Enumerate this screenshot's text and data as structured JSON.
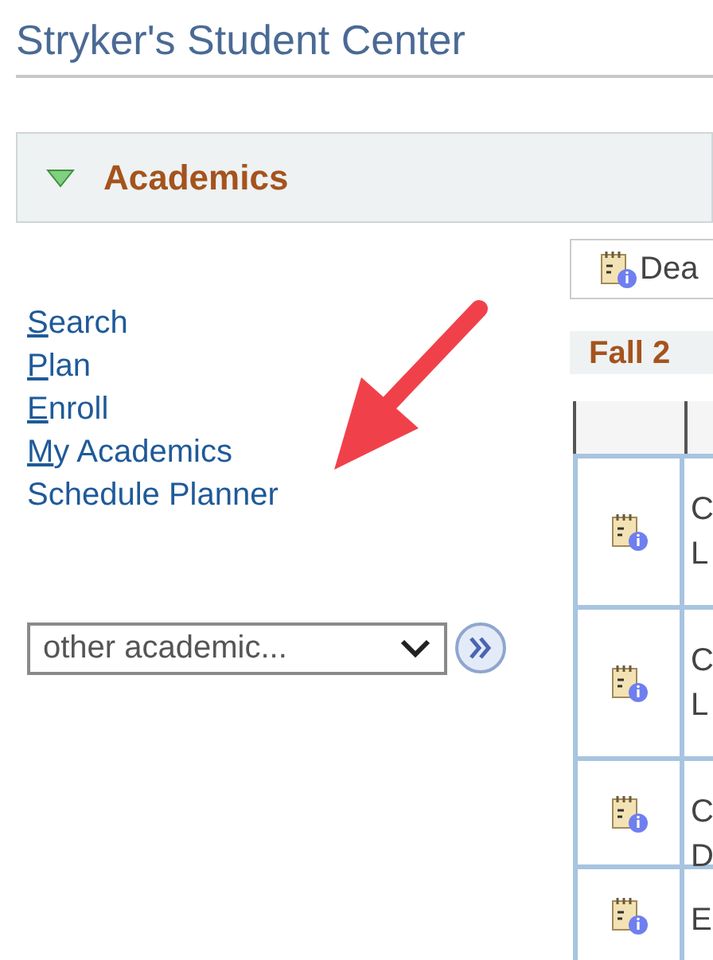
{
  "page_title": "Stryker's Student Center",
  "section": {
    "title": "Academics",
    "expanded": true
  },
  "links": [
    {
      "access_key": "S",
      "rest": "earch"
    },
    {
      "access_key": "P",
      "rest": "lan"
    },
    {
      "access_key": "E",
      "rest": "nroll"
    },
    {
      "access_key": "M",
      "rest": "y Academics"
    },
    {
      "label": "Schedule Planner"
    }
  ],
  "other_academic_select": {
    "value": "other academic..."
  },
  "deadlines_button": {
    "label": "Dea"
  },
  "term": {
    "title": "Fall 2"
  },
  "table": {
    "rows": [
      {
        "lines": [
          "C",
          "L"
        ]
      },
      {
        "lines": [
          "C",
          "L"
        ]
      },
      {
        "lines": [
          "C",
          "D"
        ]
      },
      {
        "lines": [
          "E"
        ]
      }
    ]
  }
}
